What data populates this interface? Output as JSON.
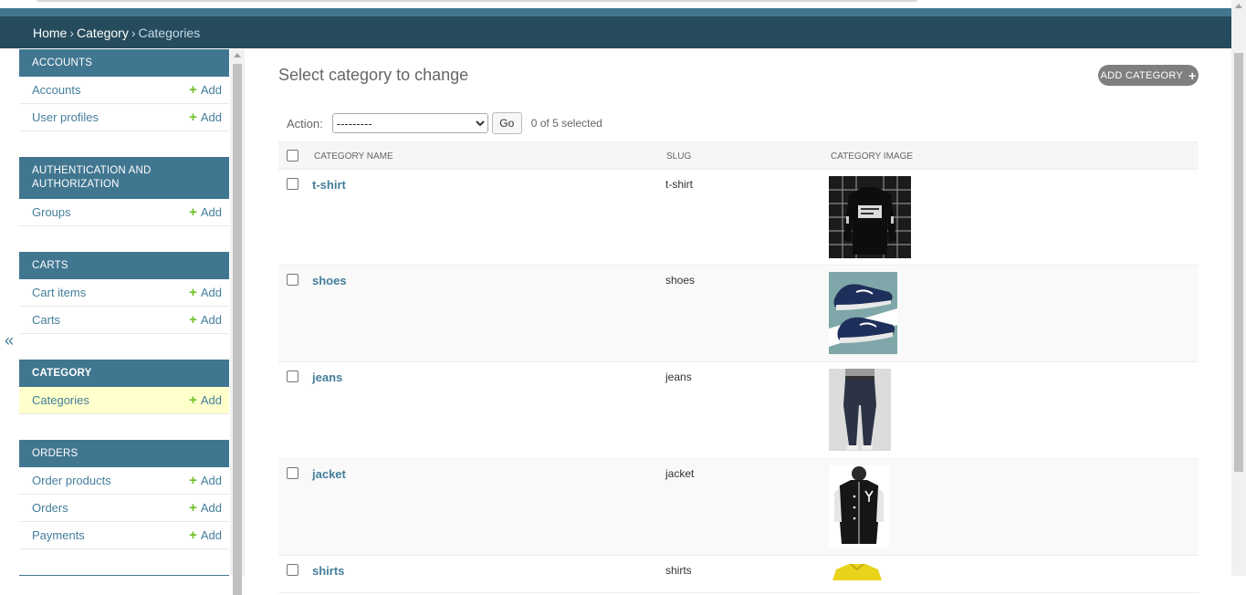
{
  "breadcrumbs": {
    "home": "Home",
    "category": "Category",
    "current": "Categories",
    "sep": "›"
  },
  "sidebar": {
    "collapse_glyph": "«",
    "modules": [
      {
        "caption": "ACCOUNTS",
        "items": [
          {
            "label": "Accounts",
            "add": "Add"
          },
          {
            "label": "User profiles",
            "add": "Add"
          }
        ]
      },
      {
        "caption": "AUTHENTICATION AND AUTHORIZATION",
        "items": [
          {
            "label": "Groups",
            "add": "Add"
          }
        ]
      },
      {
        "caption": "CARTS",
        "items": [
          {
            "label": "Cart items",
            "add": "Add"
          },
          {
            "label": "Carts",
            "add": "Add"
          }
        ]
      },
      {
        "caption": "CATEGORY",
        "items": [
          {
            "label": "Categories",
            "add": "Add"
          }
        ]
      },
      {
        "caption": "ORDERS",
        "items": [
          {
            "label": "Order products",
            "add": "Add"
          },
          {
            "label": "Orders",
            "add": "Add"
          },
          {
            "label": "Payments",
            "add": "Add"
          }
        ]
      }
    ]
  },
  "content": {
    "title": "Select category to change",
    "add_button": "ADD CATEGORY",
    "add_icon": "+",
    "action_label": "Action:",
    "action_value": "---------",
    "go_label": "Go",
    "selection_counter": "0 of 5 selected",
    "columns": [
      "CATEGORY NAME",
      "SLUG",
      "CATEGORY IMAGE"
    ],
    "rows": [
      {
        "name": "t-shirt",
        "slug": "t-shirt",
        "image": "black-sweatshirt-image"
      },
      {
        "name": "shoes",
        "slug": "shoes",
        "image": "blue-sneakers-image"
      },
      {
        "name": "jeans",
        "slug": "jeans",
        "image": "dark-jeans-image"
      },
      {
        "name": "jacket",
        "slug": "jacket",
        "image": "varsity-jacket-image"
      },
      {
        "name": "shirts",
        "slug": "shirts",
        "image": "yellow-shirt-image"
      }
    ]
  },
  "colors": {
    "header_dark": "#264b5d",
    "accent": "#417690",
    "link": "#447e9b",
    "add_green": "#70bf2b",
    "selected_row": "#ffffcc"
  }
}
